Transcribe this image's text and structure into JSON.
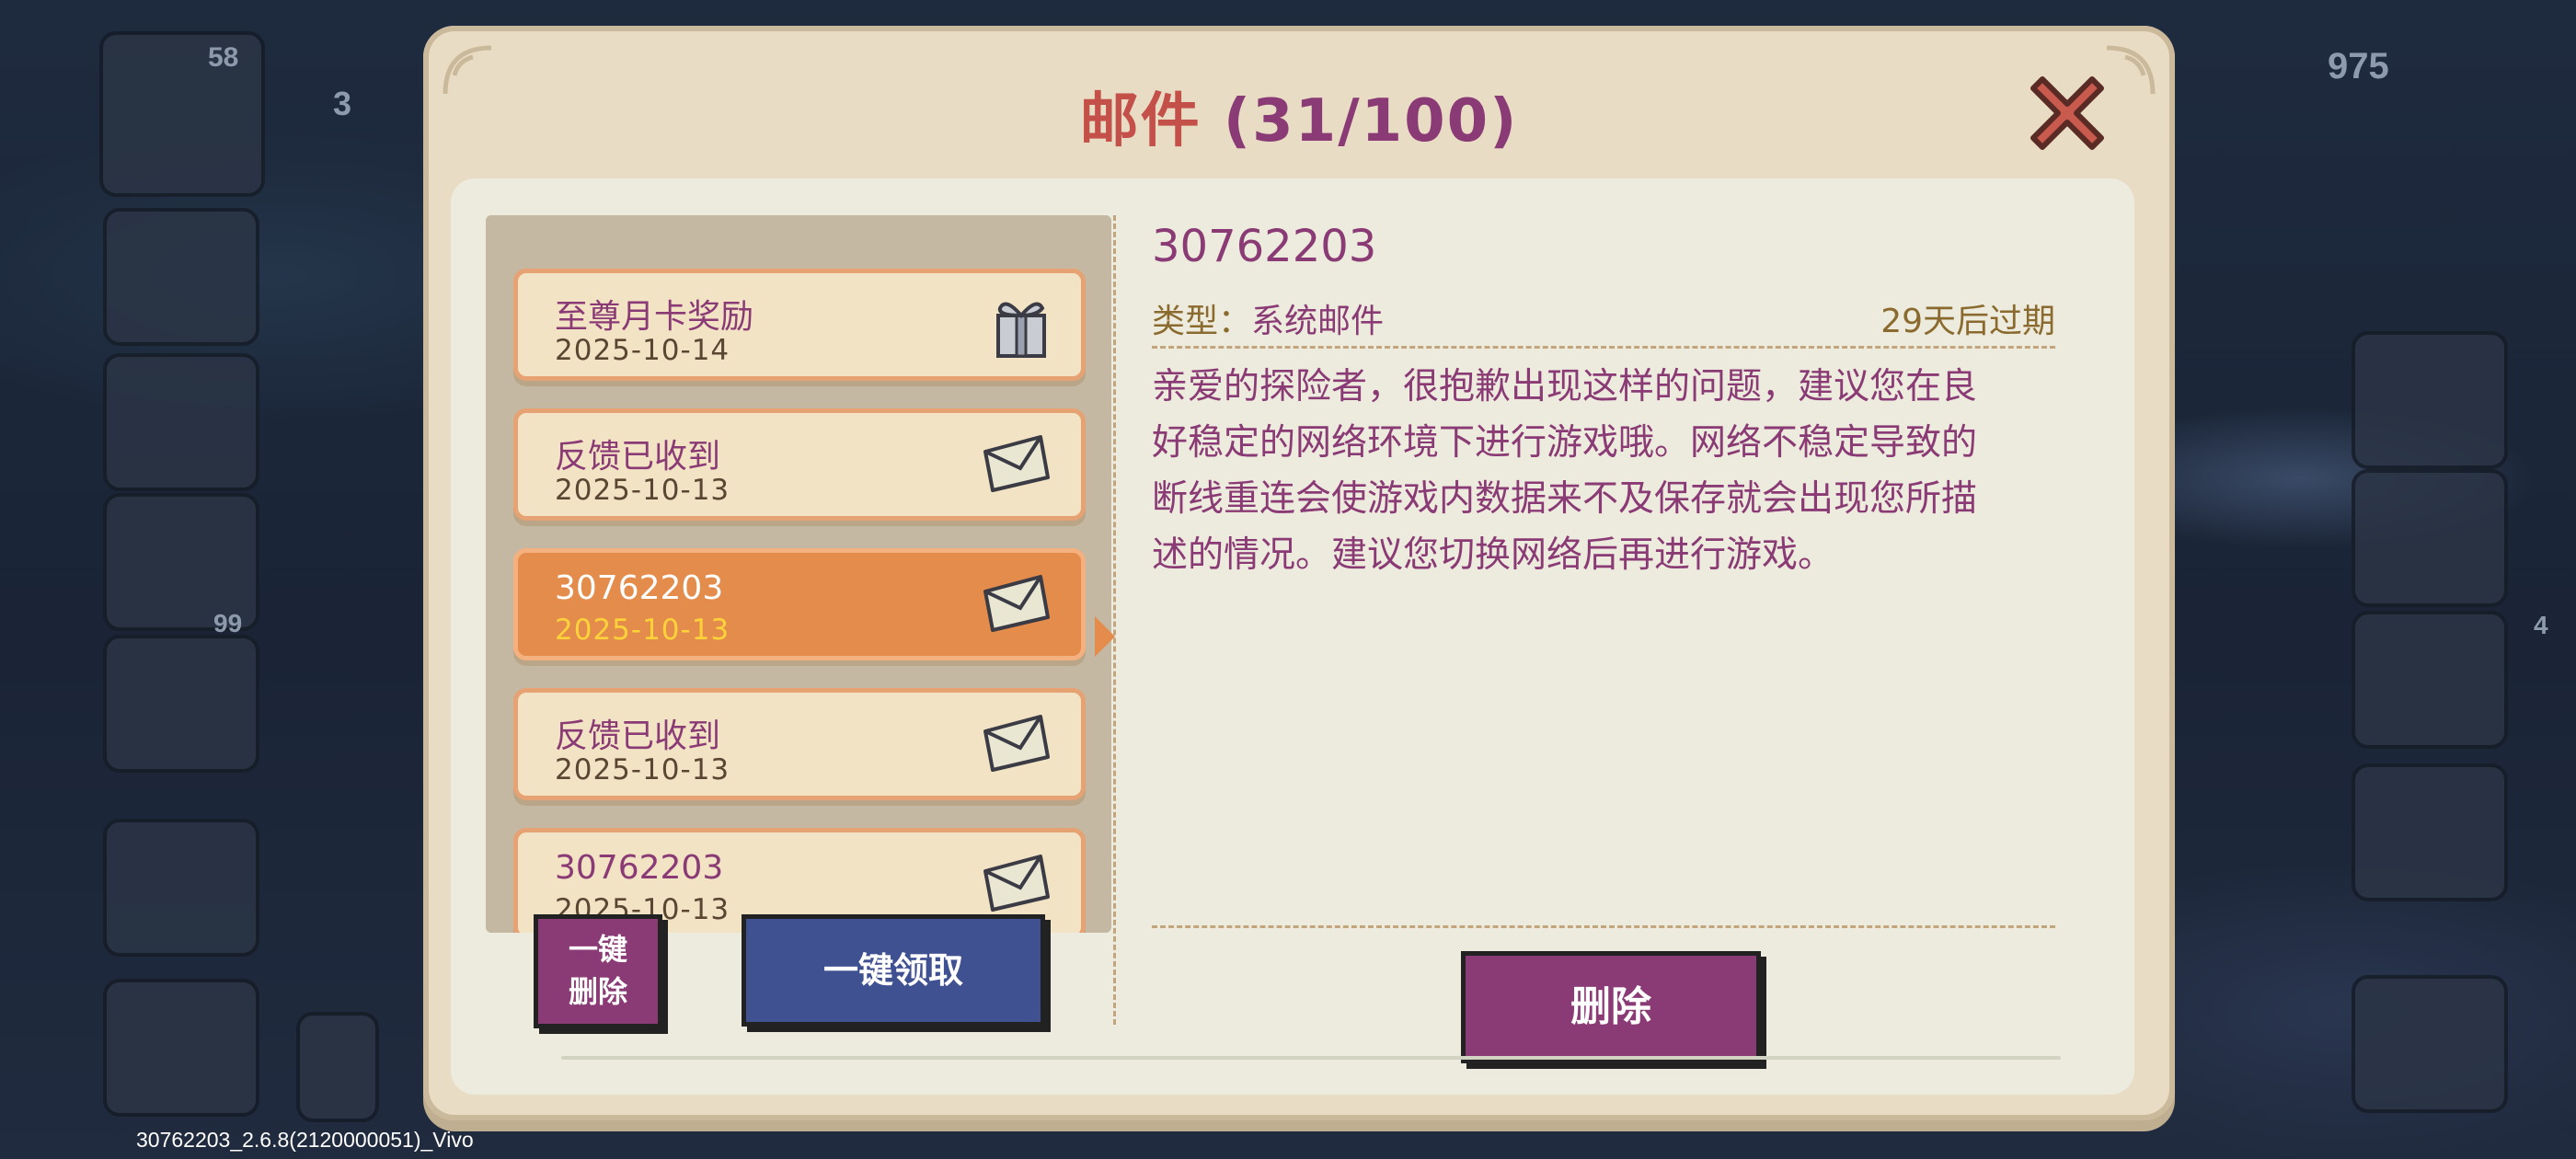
{
  "dialog": {
    "title_label": "邮件",
    "title_count": "(31/100)"
  },
  "mail_list": [
    {
      "subject": "至尊月卡奖励",
      "date": "2025-10-14",
      "icon": "gift-icon",
      "selected": false
    },
    {
      "subject": "反馈已收到",
      "date": "2025-10-13",
      "icon": "envelope-icon",
      "selected": false
    },
    {
      "subject": "30762203",
      "date": "2025-10-13",
      "icon": "envelope-icon",
      "selected": true
    },
    {
      "subject": "反馈已收到",
      "date": "2025-10-13",
      "icon": "envelope-icon",
      "selected": false
    },
    {
      "subject": "30762203",
      "date": "2025-10-13",
      "icon": "envelope-icon",
      "selected": false
    }
  ],
  "buttons": {
    "delete_all_line1": "一键",
    "delete_all_line2": "删除",
    "claim_all": "一键领取",
    "delete": "删除"
  },
  "detail": {
    "title": "30762203",
    "type_label": "类型：",
    "type_value": "系统邮件",
    "expiry": "29天后过期",
    "body": "亲爱的探险者，很抱歉出现这样的问题，建议您在良好稳定的网络环境下进行游戏哦。网络不稳定导致的断线重连会使游戏内数据来不及保存就会出现您所描述的情况。建议您切换网络后再进行游戏。"
  },
  "hud": {
    "level": "58",
    "shield_value": "3",
    "gold": "975",
    "counter": "99",
    "notif": "4"
  },
  "build_info": "30762203_2.6.8(2120000051)_Vivo",
  "colors": {
    "accent_purple": "#8a3a74",
    "title_red": "#c4504a",
    "selected_orange": "#e48c4b",
    "claim_blue": "#405192",
    "paper": "#e8dcc4"
  }
}
